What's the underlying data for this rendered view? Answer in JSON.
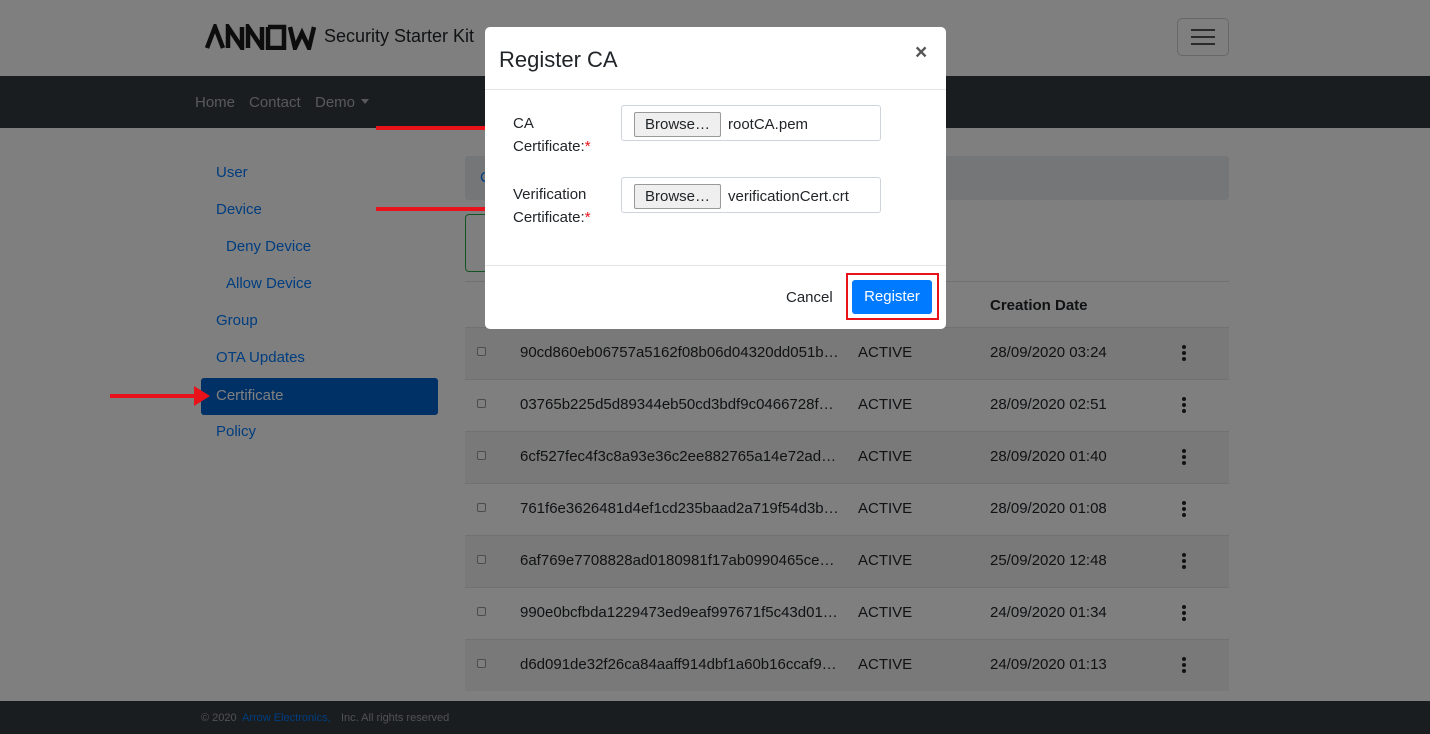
{
  "header": {
    "brand_title": "Security Starter Kit",
    "logo_icon": "arrow-logo-icon"
  },
  "navbar": {
    "home": "Home",
    "contact": "Contact",
    "demo": "Demo"
  },
  "sidebar": {
    "items": [
      {
        "label": "User"
      },
      {
        "label": "Device"
      },
      {
        "label": "Deny Device"
      },
      {
        "label": "Allow Device"
      },
      {
        "label": "Group"
      },
      {
        "label": "OTA Updates"
      },
      {
        "label": "Certificate"
      },
      {
        "label": "Policy"
      }
    ]
  },
  "table": {
    "columns": {
      "creation_date": "Creation Date"
    },
    "rows": [
      {
        "id": "90cd860eb06757a5162f08b06d04320dd051b…",
        "status": "ACTIVE",
        "date": "28/09/2020 03:24"
      },
      {
        "id": "03765b225d5d89344eb50cd3bdf9c0466728f…",
        "status": "ACTIVE",
        "date": "28/09/2020 02:51"
      },
      {
        "id": "6cf527fec4f3c8a93e36c2ee882765a14e72ad…",
        "status": "ACTIVE",
        "date": "28/09/2020 01:40"
      },
      {
        "id": "761f6e3626481d4ef1cd235baad2a719f54d3b…",
        "status": "ACTIVE",
        "date": "28/09/2020 01:08"
      },
      {
        "id": "6af769e7708828ad0180981f17ab0990465ce…",
        "status": "ACTIVE",
        "date": "25/09/2020 12:48"
      },
      {
        "id": "990e0bcfbda1229473ed9eaf997671f5c43d01…",
        "status": "ACTIVE",
        "date": "24/09/2020 01:34"
      },
      {
        "id": "d6d091de32f26ca84aaff914dbf1a60b16ccaf9…",
        "status": "ACTIVE",
        "date": "24/09/2020 01:13"
      }
    ]
  },
  "footer": {
    "prefix": "© 2020",
    "company": "Arrow Electronics,",
    "suffix": "Inc. All rights reserved"
  },
  "modal": {
    "title": "Register CA",
    "close": "×",
    "ca_label": "CA Certificate:",
    "verification_label": "Verification Certificate:",
    "required_mark": "*",
    "browse_label": "Browse…",
    "ca_file": "rootCA.pem",
    "verification_file": "verificationCert.crt",
    "cancel_label": "Cancel",
    "register_label": "Register"
  },
  "colors": {
    "primary": "#007bff",
    "active_sidebar": "#0062cc",
    "navbar": "#343a40",
    "annotation_red": "#e8121a"
  }
}
